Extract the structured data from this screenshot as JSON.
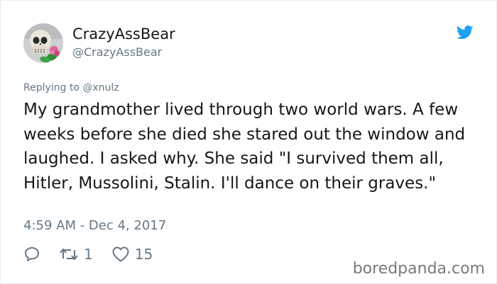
{
  "author": {
    "display_name": "CrazyAssBear",
    "handle": "@CrazyAssBear"
  },
  "tweet": {
    "reply_prefix": "Replying to",
    "reply_to": "@xnulz",
    "text": "My grandmother lived through two world wars. A few weeks before she died she stared out the window and laughed. I asked why. She said \"I survived them all, Hitler, Mussolini, Stalin. I'll dance on their graves.\"",
    "timestamp": "4:59 AM - Dec 4, 2017"
  },
  "actions": {
    "retweet_count": "1",
    "like_count": "15"
  },
  "icons": {
    "brand": "twitter-bird-icon",
    "reply": "reply-icon",
    "retweet": "retweet-icon",
    "like": "heart-icon"
  },
  "colors": {
    "twitter_blue": "#1da1f2",
    "text": "#14171a",
    "secondary": "#657786"
  },
  "watermark": "boredpanda.com"
}
